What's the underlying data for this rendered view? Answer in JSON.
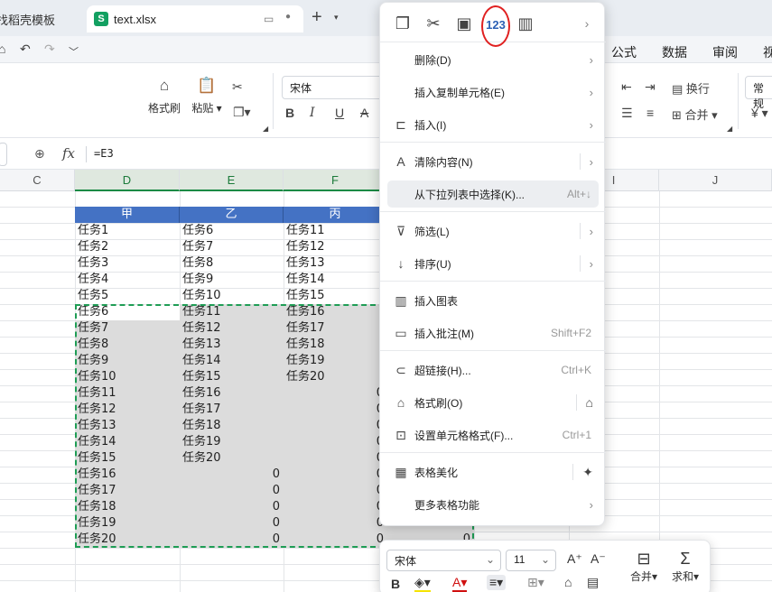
{
  "titlebar": {
    "tab_template_label": "找稻壳模板",
    "file_tab": {
      "logo": "S",
      "label": "text.xlsx"
    }
  },
  "menu_tabs": [
    "公式",
    "数据",
    "审阅",
    "视"
  ],
  "ribbon": {
    "format_painter": "格式刷",
    "paste": "粘贴",
    "font_name": "宋体",
    "wrap": "换行",
    "merge": "合并",
    "normal": "常规"
  },
  "formula": {
    "content": "=E3"
  },
  "columns": [
    "C",
    "D",
    "E",
    "F",
    "I",
    "J"
  ],
  "table": {
    "headers": [
      "甲",
      "乙",
      "丙"
    ],
    "rows": [
      [
        "任务1",
        "任务6",
        "任务11"
      ],
      [
        "任务2",
        "任务7",
        "任务12"
      ],
      [
        "任务3",
        "任务8",
        "任务13"
      ],
      [
        "任务4",
        "任务9",
        "任务14"
      ],
      [
        "任务5",
        "任务10",
        "任务15"
      ],
      [
        "任务6",
        "任务11",
        "任务16"
      ],
      [
        "任务7",
        "任务12",
        "任务17"
      ],
      [
        "任务8",
        "任务13",
        "任务18"
      ],
      [
        "任务9",
        "任务14",
        "任务19"
      ],
      [
        "任务10",
        "任务15",
        "任务20"
      ],
      [
        "任务11",
        "任务16",
        "0"
      ],
      [
        "任务12",
        "任务17",
        "0"
      ],
      [
        "任务13",
        "任务18",
        "0"
      ],
      [
        "任务14",
        "任务19",
        "0"
      ],
      [
        "任务15",
        "任务20",
        "0"
      ],
      [
        "任务16",
        "0",
        "0"
      ],
      [
        "任务17",
        "0",
        "0"
      ],
      [
        "任务18",
        "0",
        "0"
      ],
      [
        "任务19",
        "0",
        "0"
      ],
      [
        "任务20",
        "0",
        "0"
      ]
    ],
    "extra_zero": "0"
  },
  "context_menu": {
    "paste_values_icon_text": "123",
    "items": [
      {
        "label": "删除(D)",
        "shortcut": "",
        "arrow": true
      },
      {
        "label": "插入复制单元格(E)",
        "shortcut": "",
        "arrow": true
      },
      {
        "label": "插入(I)",
        "shortcut": "",
        "arrow": true
      },
      {
        "label": "清除内容(N)",
        "shortcut": "",
        "arrow": true
      },
      {
        "label": "从下拉列表中选择(K)...",
        "shortcut": "Alt+↓",
        "arrow": false
      },
      {
        "label": "筛选(L)",
        "shortcut": "",
        "arrow": true
      },
      {
        "label": "排序(U)",
        "shortcut": "",
        "arrow": true
      },
      {
        "label": "插入图表",
        "shortcut": "",
        "arrow": false
      },
      {
        "label": "插入批注(M)",
        "shortcut": "Shift+F2",
        "arrow": false
      },
      {
        "label": "超链接(H)...",
        "shortcut": "Ctrl+K",
        "arrow": false
      },
      {
        "label": "格式刷(O)",
        "shortcut": "",
        "arrow": false
      },
      {
        "label": "设置单元格格式(F)...",
        "shortcut": "Ctrl+1",
        "arrow": false
      },
      {
        "label": "表格美化",
        "shortcut": "",
        "arrow": false
      },
      {
        "label": "更多表格功能",
        "shortcut": "",
        "arrow": true
      }
    ]
  },
  "mini_toolbar": {
    "font_name": "宋体",
    "font_size": "11",
    "bold": "B",
    "merge": "合并",
    "sum": "求和"
  },
  "colors": {
    "header_fill": "#4472c4",
    "selection_border": "#1f9d55",
    "highlight_circle": "#e02020",
    "sheet_logo": "#12a061"
  }
}
